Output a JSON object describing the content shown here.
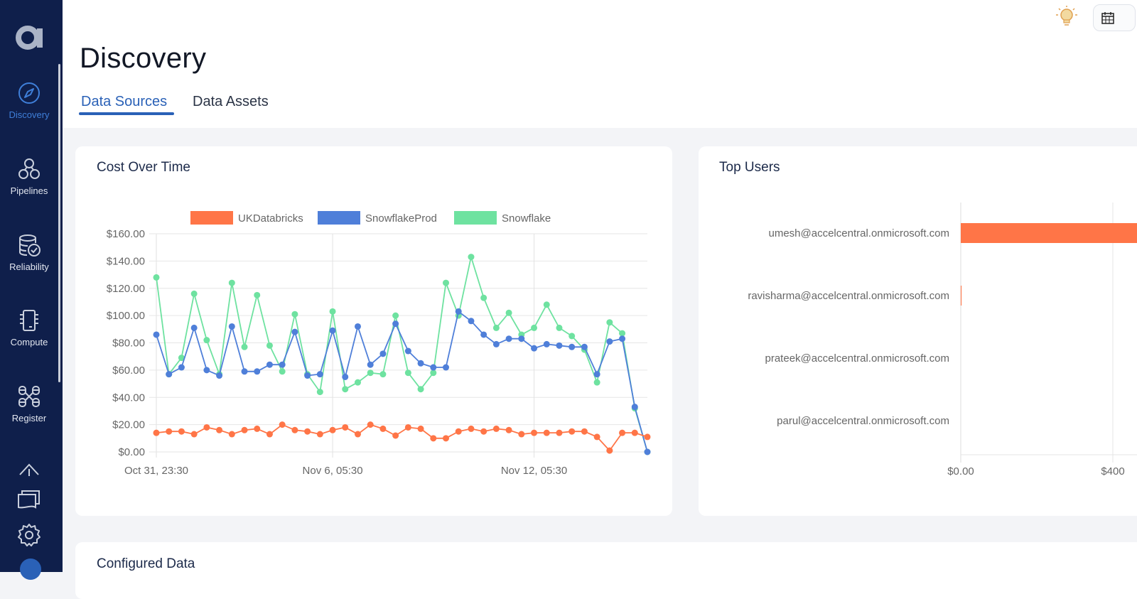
{
  "sidebar": {
    "logo": "a",
    "items": [
      {
        "label": "Discovery",
        "icon": "compass-icon",
        "active": true
      },
      {
        "label": "Pipelines",
        "icon": "pipelines-icon",
        "active": false
      },
      {
        "label": "Reliability",
        "icon": "database-check-icon",
        "active": false
      },
      {
        "label": "Compute",
        "icon": "chip-icon",
        "active": false
      },
      {
        "label": "Register",
        "icon": "register-icon",
        "active": false
      }
    ],
    "bottom_icons": [
      "cloud-upload-icon",
      "cards-icon",
      "gear-icon"
    ]
  },
  "header": {
    "title": "Discovery",
    "tabs": [
      {
        "label": "Data Sources",
        "active": true
      },
      {
        "label": "Data Assets",
        "active": false
      }
    ],
    "icons": [
      "lightbulb-icon",
      "calendar-icon"
    ]
  },
  "cost_card": {
    "title": "Cost Over Time"
  },
  "users_card": {
    "title": "Top Users"
  },
  "bottom_card": {
    "title": "Configured Data"
  },
  "colors": {
    "UKDatabricks": "#ff7547",
    "SnowflakeProd": "#4f7fd9",
    "Snowflake": "#6ee2a0"
  },
  "chart_data": [
    {
      "type": "line",
      "title": "Cost Over Time",
      "xlabel": "",
      "ylabel": "",
      "ylim": [
        0,
        160
      ],
      "yticks": [
        "$0.00",
        "$20.00",
        "$40.00",
        "$60.00",
        "$80.00",
        "$100.00",
        "$120.00",
        "$140.00",
        "$160.00"
      ],
      "xtick_labels": [
        {
          "index": 0,
          "label": "Oct 31, 23:30"
        },
        {
          "index": 14,
          "label": "Nov 6, 05:30"
        },
        {
          "index": 30,
          "label": "Nov 12, 05:30"
        }
      ],
      "legend": "top-center",
      "grid": true,
      "n_points": 40,
      "series": [
        {
          "name": "UKDatabricks",
          "color": "#ff7547",
          "values": [
            14,
            15,
            15,
            13,
            18,
            16,
            13,
            16,
            17,
            13,
            20,
            16,
            15,
            13,
            16,
            18,
            13,
            20,
            17,
            12,
            18,
            17,
            10,
            10,
            15,
            17,
            15,
            17,
            16,
            13,
            14,
            14,
            14,
            15,
            15,
            11,
            1,
            14,
            14,
            11
          ]
        },
        {
          "name": "SnowflakeProd",
          "color": "#4f7fd9",
          "values": [
            86,
            57,
            62,
            91,
            60,
            56,
            92,
            59,
            59,
            64,
            64,
            88,
            56,
            57,
            89,
            55,
            92,
            64,
            72,
            94,
            74,
            65,
            62,
            62,
            103,
            96,
            86,
            79,
            83,
            83,
            76,
            79,
            78,
            77,
            77,
            57,
            81,
            83,
            33,
            0
          ]
        },
        {
          "name": "Snowflake",
          "color": "#6ee2a0",
          "values": [
            128,
            57,
            69,
            116,
            82,
            57,
            124,
            77,
            115,
            78,
            59,
            101,
            57,
            44,
            103,
            46,
            51,
            58,
            57,
            100,
            58,
            46,
            58,
            124,
            100,
            143,
            113,
            91,
            102,
            86,
            91,
            108,
            91,
            85,
            75,
            51,
            95,
            87,
            32,
            0
          ]
        }
      ]
    },
    {
      "type": "bar",
      "orientation": "horizontal",
      "title": "Top Users",
      "categories": [
        "umesh@accelcentral.onmicrosoft.com",
        "ravisharma@accelcentral.onmicrosoft.com",
        "prateek@accelcentral.onmicrosoft.com",
        "parul@accelcentral.onmicrosoft.com"
      ],
      "values": [
        470,
        2,
        0,
        0
      ],
      "color": "#ff7547",
      "xticks": [
        "$0.00",
        "$400"
      ],
      "xlim": [
        0,
        450
      ],
      "grid": true
    }
  ]
}
